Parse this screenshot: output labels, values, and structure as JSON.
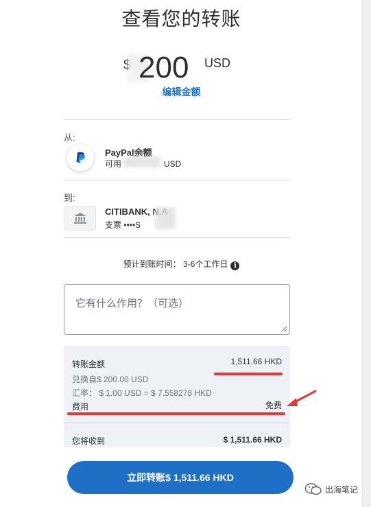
{
  "page": {
    "title": "查看您的转账",
    "amount_prefix": "$",
    "amount_value": "200",
    "amount_currency": "USD",
    "edit_amount": "编辑金额"
  },
  "from": {
    "label": "从:",
    "name": "PayPal余额",
    "available_prefix": "可用",
    "available_suffix": "USD",
    "icon": "paypal-logo-icon"
  },
  "to": {
    "label": "到:",
    "name": "CITIBANK, N.A",
    "account": "支票 ••••S",
    "icon": "bank-icon"
  },
  "eta": {
    "text": "预计到账时间： 3-6个工作日",
    "icon": "info-icon"
  },
  "note": {
    "placeholder": "它有什么作用？（可选）"
  },
  "summary": {
    "transfer_label": "转账金额",
    "transfer_value": "1,511.66 HKD",
    "converted_from": "兑换自$ 200.00 USD",
    "rate": "汇率： $ 1.00 USD = $ 7.558278 HKD",
    "fee_label": "费用",
    "fee_value": "免费",
    "receive_label": "您将收到",
    "receive_value": "$ 1,511.66 HKD"
  },
  "button": {
    "label": "立即转账$ 1,511.66 HKD"
  },
  "watermark": {
    "text": "出海笔记"
  },
  "colors": {
    "accent": "#1f6fc6",
    "link": "#1a73c4",
    "annotation_red": "#e53935",
    "summary_bg": "#eef1f5"
  }
}
